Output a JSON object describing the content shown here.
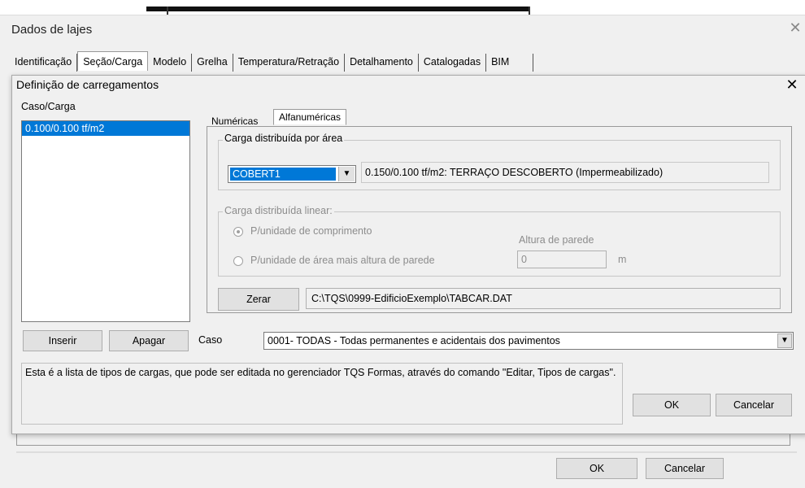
{
  "outer_dialog": {
    "title": "Dados de lajes",
    "close_glyph": "✕",
    "tabs": [
      "Identificação",
      "Seção/Carga",
      "Modelo",
      "Grelha",
      "Temperatura/Retração",
      "Detalhamento",
      "Catalogadas",
      "BIM"
    ],
    "active_tab": "Seção/Carga",
    "ok_label": "OK",
    "cancel_label": "Cancelar"
  },
  "inner_dialog": {
    "title": "Definição de carregamentos",
    "close_glyph": "✕",
    "caso_carga_label": "Caso/Carga",
    "list_items": [
      "0.100/0.100 tf/m2"
    ],
    "tabs": [
      "Numéricas",
      "Alfanuméricas"
    ],
    "active_tab": "Alfanuméricas",
    "area_group": {
      "legend": "Carga distribuída por área",
      "combo_value": "COBERT1",
      "description": "0.150/0.100 tf/m2: TERRAÇO DESCOBERTO (Impermeabilizado)"
    },
    "linear_group": {
      "legend": "Carga distribuída linear:",
      "radio_1": "P/unidade de comprimento",
      "radio_2": "P/unidade de área mais altura de parede",
      "altura_label": "Altura de parede",
      "altura_value": "0",
      "unit": "m"
    },
    "zerar_label": "Zerar",
    "path": "C:\\TQS\\0999-EdificioExemplo\\TABCAR.DAT",
    "inserir_label": "Inserir",
    "apagar_label": "Apagar",
    "caso_label": "Caso",
    "caso_value": "0001- TODAS - Todas permanentes e acidentais dos pavimentos",
    "info_text": "Esta é a lista de tipos de cargas, que pode ser editada no gerenciador TQS Formas, através do comando \"Editar, Tipos de cargas\".",
    "ok_label": "OK",
    "cancel_label": "Cancelar"
  },
  "icons": {
    "dropdown": "chevron-down-icon",
    "close": "close-icon"
  },
  "colors": {
    "selection": "#0078d7",
    "dialog_bg": "#f0f0f0"
  }
}
